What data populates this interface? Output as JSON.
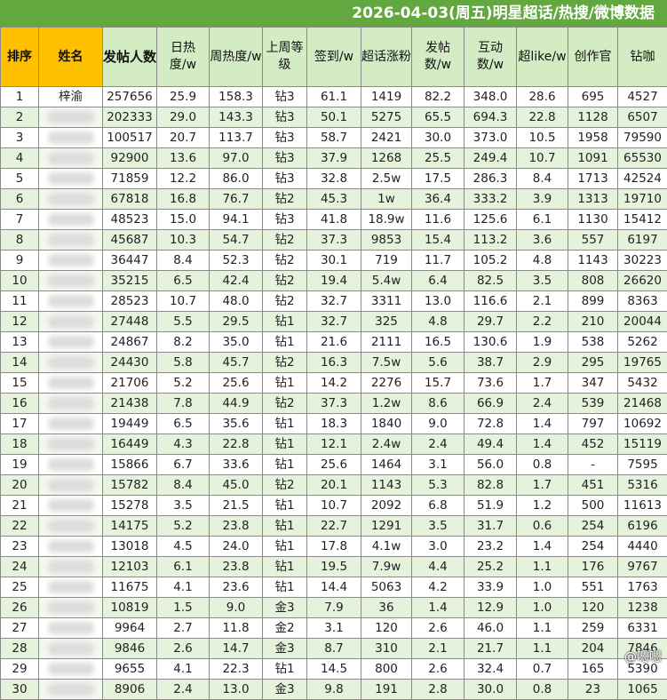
{
  "title": "2026-04-03(周五)明星超话/热搜/微博数据",
  "colors": {
    "title_bg": "#62a83f",
    "header_bg": "#d3ecc4",
    "highlight": "#ffc000",
    "red_text": "#a8192f",
    "blue_text": "#2b4aa8",
    "row_alt": "#e5f2dc"
  },
  "headers": [
    "排序",
    "姓名",
    "发帖人数",
    "日热度/w",
    "周热度/w",
    "上周等级",
    "签到/w",
    "超话涨粉",
    "发帖数/w",
    "互动数/w",
    "超like/w",
    "创作官",
    "钻咖"
  ],
  "rows": [
    {
      "cells": [
        "1",
        "梓渝",
        "257656",
        "25.9",
        "158.3",
        "钻3",
        "61.1",
        "1419",
        "82.2",
        "348.0",
        "28.6",
        "695",
        "4527"
      ],
      "colors": {}
    },
    {
      "cells": [
        "2",
        "",
        "202333",
        "29.0",
        "143.3",
        "钻3",
        "50.1",
        "5275",
        "65.5",
        "694.3",
        "22.8",
        "1128",
        "6507"
      ],
      "colors": {
        "7": "red"
      }
    },
    {
      "cells": [
        "3",
        "",
        "100517",
        "20.7",
        "113.7",
        "钻3",
        "58.7",
        "2421",
        "30.0",
        "373.0",
        "10.5",
        "1958",
        "79590"
      ],
      "colors": {}
    },
    {
      "cells": [
        "4",
        "",
        "92900",
        "13.6",
        "97.0",
        "钻3",
        "37.9",
        "1268",
        "25.5",
        "249.4",
        "10.7",
        "1091",
        "65530"
      ],
      "colors": {}
    },
    {
      "cells": [
        "5",
        "",
        "71859",
        "12.2",
        "86.0",
        "钻3",
        "32.8",
        "2.5w",
        "17.5",
        "286.3",
        "8.4",
        "1713",
        "42524"
      ],
      "colors": {
        "6": "blue",
        "7": "red"
      }
    },
    {
      "cells": [
        "6",
        "",
        "67818",
        "16.8",
        "76.7",
        "钻2",
        "45.3",
        "1w",
        "36.4",
        "333.2",
        "3.9",
        "1313",
        "19710"
      ],
      "colors": {
        "2": "red",
        "6": "red",
        "7": "red"
      }
    },
    {
      "cells": [
        "7",
        "",
        "48523",
        "15.0",
        "94.1",
        "钻3",
        "41.8",
        "18.9w",
        "11.6",
        "125.6",
        "6.1",
        "1130",
        "15412"
      ],
      "colors": {
        "7": "red"
      }
    },
    {
      "cells": [
        "8",
        "",
        "45687",
        "10.3",
        "54.7",
        "钻2",
        "37.3",
        "9853",
        "15.4",
        "113.2",
        "3.6",
        "557",
        "6197"
      ],
      "colors": {
        "6": "red",
        "7": "red"
      }
    },
    {
      "cells": [
        "9",
        "",
        "36447",
        "8.4",
        "52.3",
        "钻2",
        "30.1",
        "719",
        "11.7",
        "105.2",
        "4.8",
        "1143",
        "30223"
      ],
      "colors": {}
    },
    {
      "cells": [
        "10",
        "",
        "35215",
        "6.5",
        "42.4",
        "钻2",
        "19.4",
        "5.4w",
        "6.4",
        "82.5",
        "3.5",
        "808",
        "26620"
      ],
      "colors": {
        "7": "red"
      }
    },
    {
      "cells": [
        "11",
        "",
        "28523",
        "10.7",
        "48.0",
        "钻2",
        "32.7",
        "3311",
        "13.0",
        "116.6",
        "2.1",
        "899",
        "8363"
      ],
      "colors": {
        "6": "red"
      }
    },
    {
      "cells": [
        "12",
        "",
        "27448",
        "5.5",
        "29.5",
        "钻1",
        "32.7",
        "325",
        "4.8",
        "29.7",
        "2.2",
        "210",
        "20044"
      ],
      "colors": {
        "2": "red"
      }
    },
    {
      "cells": [
        "13",
        "",
        "24867",
        "8.2",
        "35.0",
        "钻1",
        "21.6",
        "2111",
        "16.5",
        "130.6",
        "1.9",
        "538",
        "5262"
      ],
      "colors": {
        "2": "red",
        "3": "red",
        "6": "red"
      }
    },
    {
      "cells": [
        "14",
        "",
        "24430",
        "5.8",
        "45.7",
        "钻2",
        "16.3",
        "7.5w",
        "5.6",
        "38.7",
        "2.9",
        "295",
        "19765"
      ],
      "colors": {
        "3": "blue",
        "6": "blue",
        "7": "red"
      }
    },
    {
      "cells": [
        "15",
        "",
        "21706",
        "5.2",
        "25.6",
        "钻1",
        "14.2",
        "2276",
        "15.7",
        "73.6",
        "1.7",
        "347",
        "5432"
      ],
      "colors": {
        "2": "red",
        "6": "red"
      }
    },
    {
      "cells": [
        "16",
        "",
        "21438",
        "7.8",
        "44.9",
        "钻2",
        "37.3",
        "1.2w",
        "8.6",
        "66.9",
        "2.4",
        "539",
        "21468"
      ],
      "colors": {
        "6": "red",
        "7": "red"
      }
    },
    {
      "cells": [
        "17",
        "",
        "19449",
        "6.5",
        "35.6",
        "钻1",
        "18.3",
        "1840",
        "9.0",
        "72.8",
        "1.4",
        "797",
        "10692"
      ],
      "colors": {
        "6": "red"
      }
    },
    {
      "cells": [
        "18",
        "",
        "16449",
        "4.3",
        "22.8",
        "钻1",
        "12.1",
        "2.4w",
        "2.4",
        "49.4",
        "1.4",
        "452",
        "15119"
      ],
      "colors": {
        "7": "red"
      }
    },
    {
      "cells": [
        "19",
        "",
        "15866",
        "6.7",
        "33.6",
        "钻1",
        "25.6",
        "1464",
        "3.1",
        "56.0",
        "0.8",
        "-",
        "7595"
      ],
      "colors": {}
    },
    {
      "cells": [
        "20",
        "",
        "15782",
        "8.4",
        "45.0",
        "钻2",
        "20.1",
        "1143",
        "5.3",
        "82.8",
        "1.7",
        "451",
        "5316"
      ],
      "colors": {}
    },
    {
      "cells": [
        "21",
        "",
        "15278",
        "3.5",
        "21.5",
        "钻1",
        "10.7",
        "2092",
        "6.8",
        "51.9",
        "1.2",
        "500",
        "11613"
      ],
      "colors": {
        "3": "blue"
      }
    },
    {
      "cells": [
        "22",
        "",
        "14175",
        "5.2",
        "23.8",
        "钻1",
        "22.7",
        "1291",
        "3.5",
        "31.7",
        "0.6",
        "254",
        "6196"
      ],
      "colors": {
        "2": "red",
        "6": "red"
      }
    },
    {
      "cells": [
        "23",
        "",
        "13018",
        "4.5",
        "24.0",
        "钻1",
        "17.8",
        "4.1w",
        "3.0",
        "23.2",
        "1.4",
        "254",
        "4440"
      ],
      "colors": {
        "3": "blue",
        "7": "red"
      }
    },
    {
      "cells": [
        "24",
        "",
        "12103",
        "6.1",
        "23.8",
        "钻1",
        "19.5",
        "7.9w",
        "4.4",
        "25.2",
        "1.1",
        "176",
        "9767"
      ],
      "colors": {
        "3": "red",
        "6": "blue",
        "7": "red"
      }
    },
    {
      "cells": [
        "25",
        "",
        "11675",
        "4.1",
        "23.6",
        "钻1",
        "14.4",
        "5063",
        "4.2",
        "33.9",
        "1.0",
        "551",
        "1763"
      ],
      "colors": {
        "6": "red",
        "7": "red"
      }
    },
    {
      "cells": [
        "26",
        "",
        "10819",
        "1.5",
        "9.0",
        "金3",
        "7.9",
        "36",
        "1.4",
        "12.9",
        "1.0",
        "120",
        "1238"
      ],
      "colors": {
        "6": "blue"
      }
    },
    {
      "cells": [
        "27",
        "",
        "9964",
        "2.7",
        "11.8",
        "金2",
        "3.1",
        "120",
        "2.6",
        "46.0",
        "1.1",
        "259",
        "6331"
      ],
      "colors": {
        "3": "red"
      }
    },
    {
      "cells": [
        "28",
        "",
        "9846",
        "2.6",
        "14.7",
        "金3",
        "8.7",
        "310",
        "2.1",
        "21.7",
        "1.1",
        "204",
        "7846"
      ],
      "colors": {}
    },
    {
      "cells": [
        "29",
        "",
        "9655",
        "4.1",
        "22.3",
        "钻1",
        "14.5",
        "800",
        "2.6",
        "32.4",
        "0.7",
        "165",
        "5390"
      ],
      "colors": {}
    },
    {
      "cells": [
        "30",
        "",
        "8906",
        "2.4",
        "13.0",
        "金3",
        "9.8",
        "191",
        "2.8",
        "30.0",
        "0.8",
        "23",
        "1065"
      ],
      "colors": {
        "3": "blue"
      }
    }
  ],
  "watermark": "@嗯嗯"
}
